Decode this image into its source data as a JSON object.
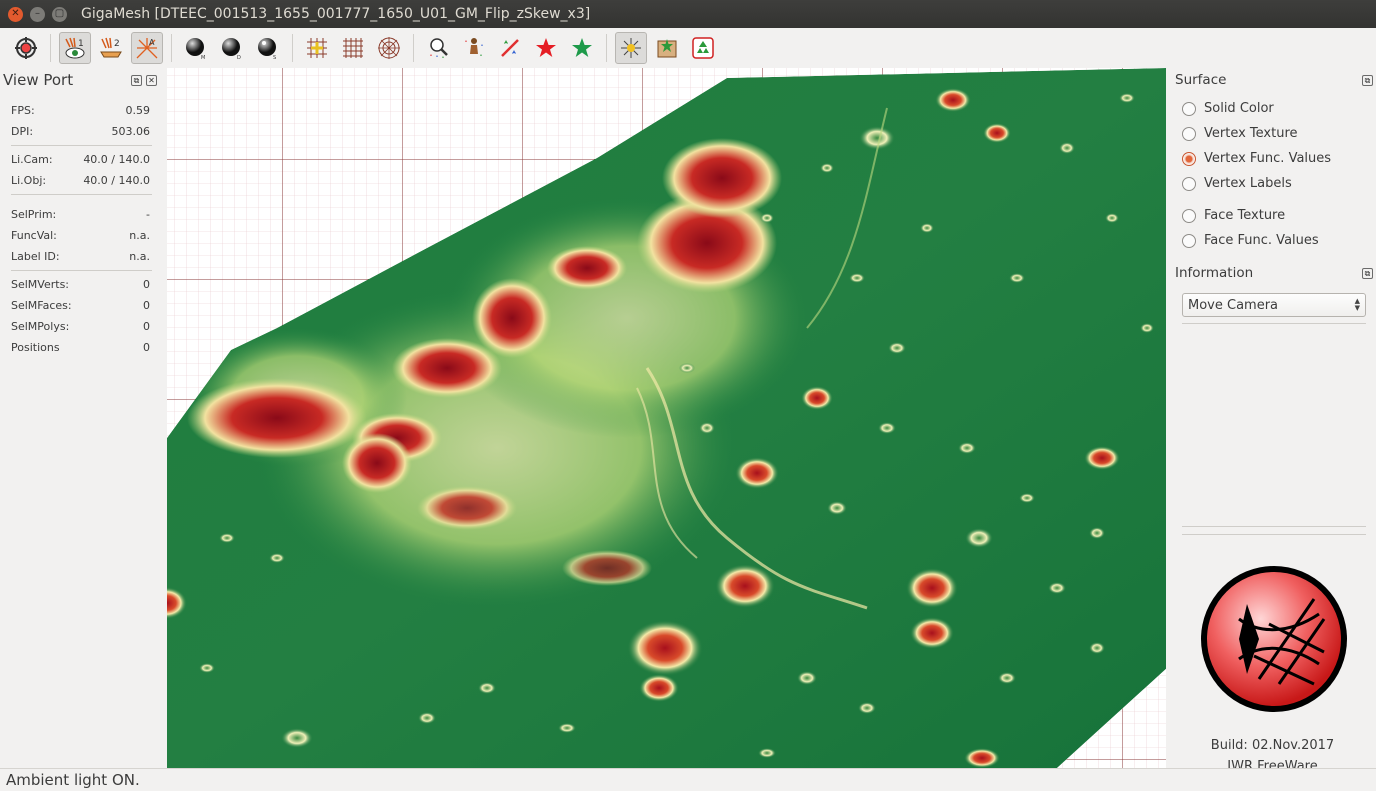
{
  "window": {
    "title": "GigaMesh [DTEEC_001513_1655_001777_1650_U01_GM_Flip_zSkew_x3]"
  },
  "toolbar": {
    "buttons": [
      {
        "icon": "settings-wheel-icon"
      },
      {
        "icon": "eye-light1-icon",
        "active": true
      },
      {
        "icon": "light2-icon"
      },
      {
        "icon": "light-ambient-icon",
        "active": true
      },
      {
        "icon": "sphere-m-icon"
      },
      {
        "icon": "sphere-d-icon"
      },
      {
        "icon": "sphere-s-icon"
      },
      {
        "icon": "grid-cross-icon"
      },
      {
        "icon": "grid-icon"
      },
      {
        "icon": "polar-grid-icon"
      },
      {
        "icon": "stars-lens-icon"
      },
      {
        "icon": "figure-stars-icon"
      },
      {
        "icon": "no-stars-icon"
      },
      {
        "icon": "red-star-icon"
      },
      {
        "icon": "green-star-icon"
      },
      {
        "icon": "sparkle-icon",
        "active": true
      },
      {
        "icon": "star-box-icon"
      },
      {
        "icon": "recycle-star-icon"
      }
    ]
  },
  "viewport_panel": {
    "title": "View Port",
    "stats": [
      {
        "label": "FPS:",
        "value": "0.59"
      },
      {
        "label": "DPI:",
        "value": "503.06"
      },
      {
        "label": "Li.Cam:",
        "value": "40.0 / 140.0"
      },
      {
        "label": "Li.Obj:",
        "value": "40.0 / 140.0"
      },
      {
        "label": "SelPrim:",
        "value": "-"
      },
      {
        "label": "FuncVal:",
        "value": "n.a."
      },
      {
        "label": "Label ID:",
        "value": "n.a."
      },
      {
        "label": "SelMVerts:",
        "value": "0"
      },
      {
        "label": "SelMFaces:",
        "value": "0"
      },
      {
        "label": "SelMPolys:",
        "value": "0"
      },
      {
        "label": "Positions",
        "value": "0"
      }
    ]
  },
  "surface_panel": {
    "title": "Surface",
    "options": [
      {
        "label": "Solid Color",
        "selected": false
      },
      {
        "label": "Vertex Texture",
        "selected": false
      },
      {
        "label": "Vertex Func. Values",
        "selected": true
      },
      {
        "label": "Vertex Labels",
        "selected": false
      },
      {
        "label": "Face Texture",
        "selected": false
      },
      {
        "label": "Face Func. Values",
        "selected": false
      }
    ]
  },
  "information_panel": {
    "title": "Information",
    "mode_select": "Move Camera"
  },
  "about": {
    "build": "Build: 02.Nov.2017",
    "license": "IWR FreeWare"
  },
  "status": {
    "message": "Ambient light ON."
  },
  "colors": {
    "terrain_low": "#1a7a3c",
    "terrain_mid": "#f2e8a0",
    "terrain_high": "#a8101c",
    "accent": "#e2663a"
  }
}
